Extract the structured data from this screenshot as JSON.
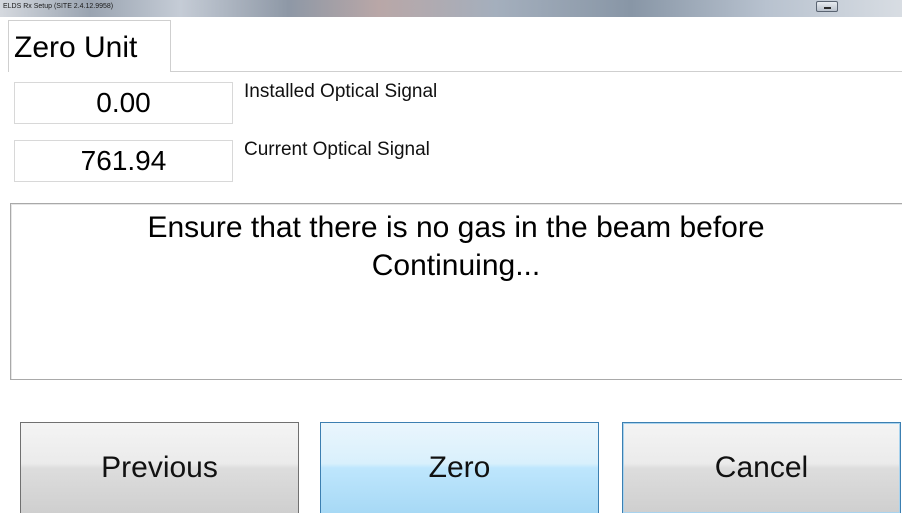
{
  "window": {
    "title": "ELDS Rx Setup (SITE 2.4.12.9958)"
  },
  "tab": {
    "label": "Zero Unit"
  },
  "signals": [
    {
      "value": "0.00",
      "label": "Installed Optical Signal"
    },
    {
      "value": "761.94",
      "label": "Current Optical Signal"
    }
  ],
  "message": {
    "text": "Ensure that there is no gas in the beam before\nContinuing..."
  },
  "buttons": {
    "previous": "Previous",
    "zero": "Zero",
    "cancel": "Cancel"
  },
  "colors": {
    "zero_button_highlight": "#bee6fd",
    "focus_border": "#3c7fb1"
  }
}
